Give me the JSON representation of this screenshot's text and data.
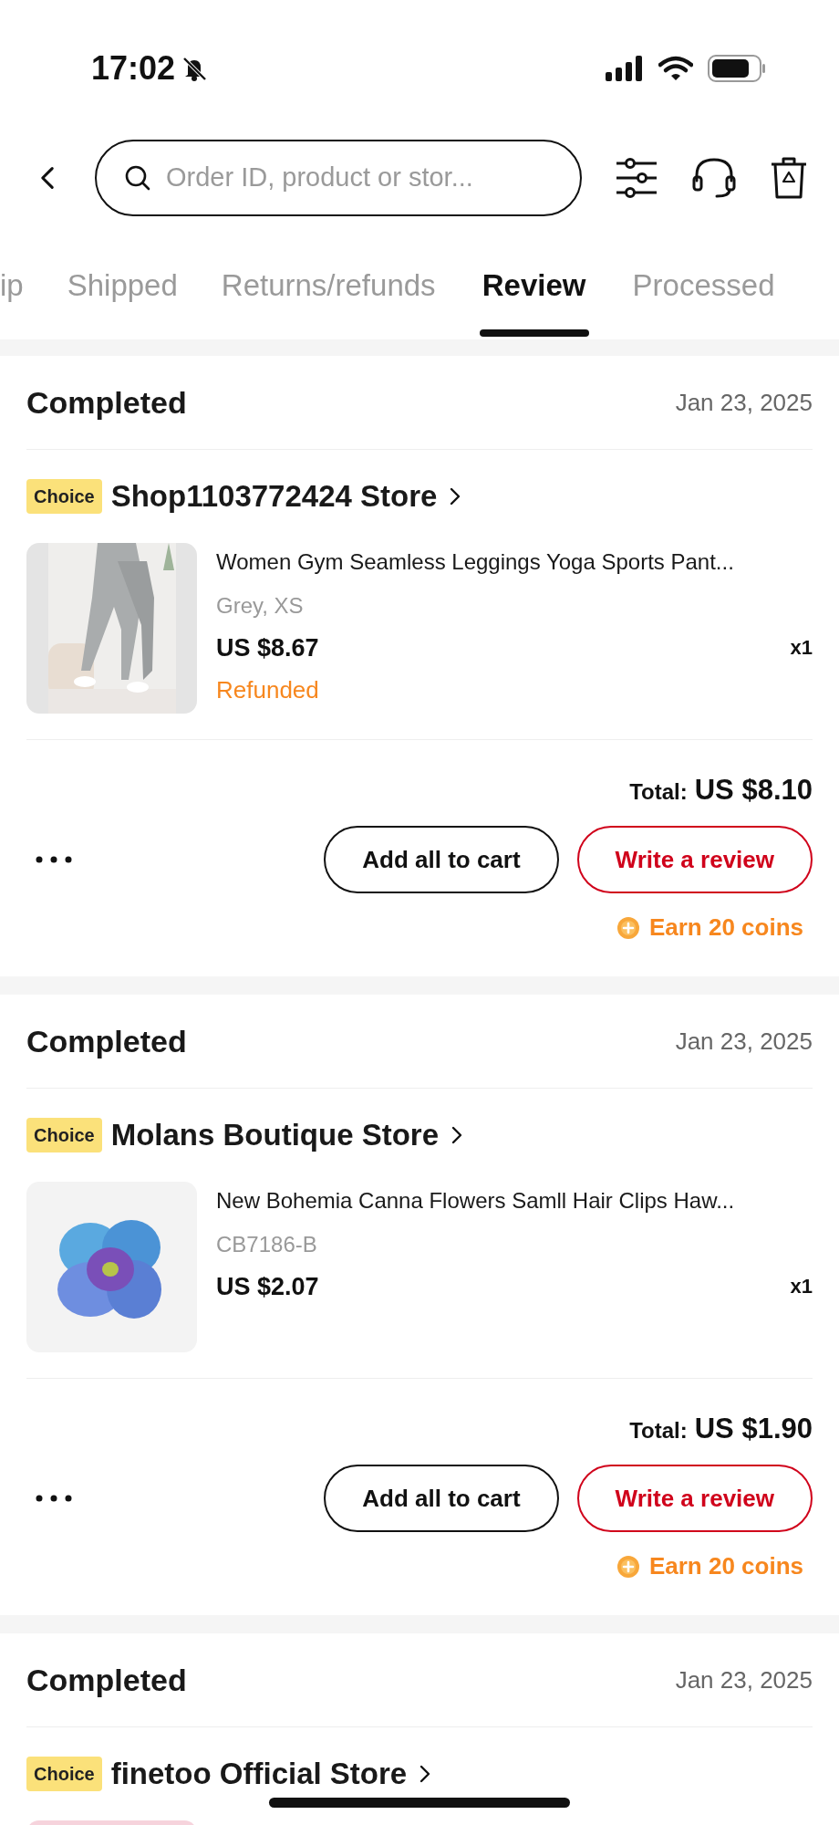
{
  "status_bar": {
    "time": "17:02",
    "silent": true
  },
  "search": {
    "placeholder": "Order ID, product or stor..."
  },
  "tabs": [
    {
      "label": "ip",
      "selected": false
    },
    {
      "label": "Shipped",
      "selected": false
    },
    {
      "label": "Returns/refunds",
      "selected": false
    },
    {
      "label": "Review",
      "selected": true
    },
    {
      "label": "Processed",
      "selected": false
    }
  ],
  "orders": [
    {
      "status": "Completed",
      "date": "Jan 23, 2025",
      "badge": "Choice",
      "store": "Shop1103772424 Store",
      "items": [
        {
          "kind": "product",
          "title": "Women Gym Seamless Leggings Yoga Sports Pant...",
          "variant": "Grey, XS",
          "price": "US $8.67",
          "quantity": "x1",
          "refund_status": "Refunded"
        }
      ],
      "total_label": "Total:",
      "total": "US $8.10",
      "actions": [
        {
          "label": "Add all to cart",
          "kind": "secondary"
        },
        {
          "label": "Write a review",
          "kind": "primary"
        }
      ],
      "reward": "Earn 20 coins"
    },
    {
      "status": "Completed",
      "date": "Jan 23, 2025",
      "badge": "Choice",
      "store": "Molans Boutique Store",
      "items": [
        {
          "kind": "product",
          "title": "New Bohemia Canna Flowers Samll Hair Clips Haw...",
          "variant": "CB7186-B",
          "price": "US $2.07",
          "quantity": "x1"
        }
      ],
      "total_label": "Total:",
      "total": "US $1.90",
      "actions": [
        {
          "label": "Add all to cart",
          "kind": "secondary"
        },
        {
          "label": "Write a review",
          "kind": "primary"
        }
      ],
      "reward": "Earn 20 coins"
    },
    {
      "status": "Completed",
      "date": "Jan 23, 2025",
      "badge": "Choice",
      "store": "finetoo Official Store"
    }
  ]
}
